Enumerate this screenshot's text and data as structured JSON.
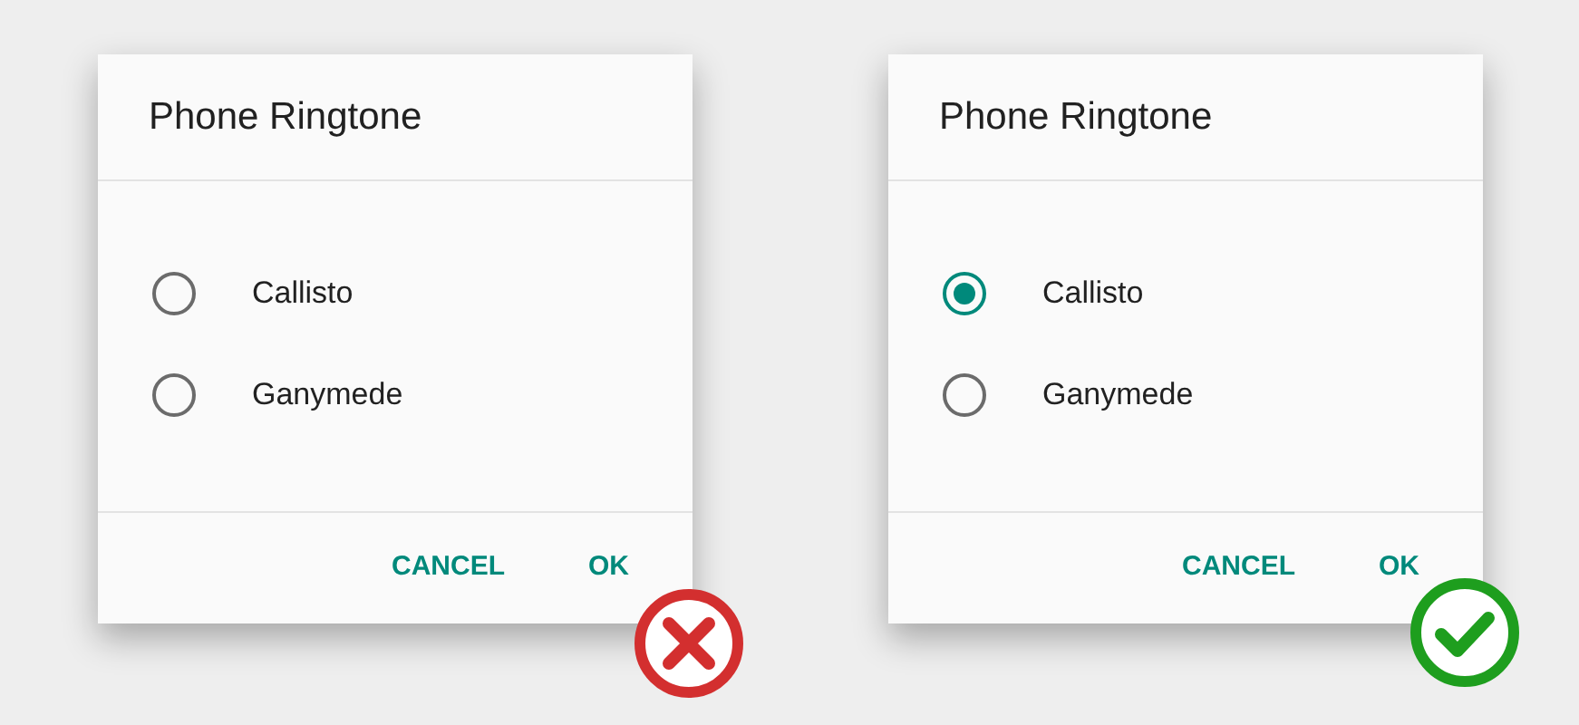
{
  "dialogs": [
    {
      "kind": "bad",
      "title": "Phone Ringtone",
      "options": [
        {
          "label": "Callisto",
          "selected": false
        },
        {
          "label": "Ganymede",
          "selected": false
        }
      ],
      "buttons": [
        "CANCEL",
        "OK"
      ]
    },
    {
      "kind": "good",
      "title": "Phone Ringtone",
      "options": [
        {
          "label": "Callisto",
          "selected": true
        },
        {
          "label": "Ganymede",
          "selected": false
        }
      ],
      "buttons": [
        "CANCEL",
        "OK"
      ]
    }
  ]
}
